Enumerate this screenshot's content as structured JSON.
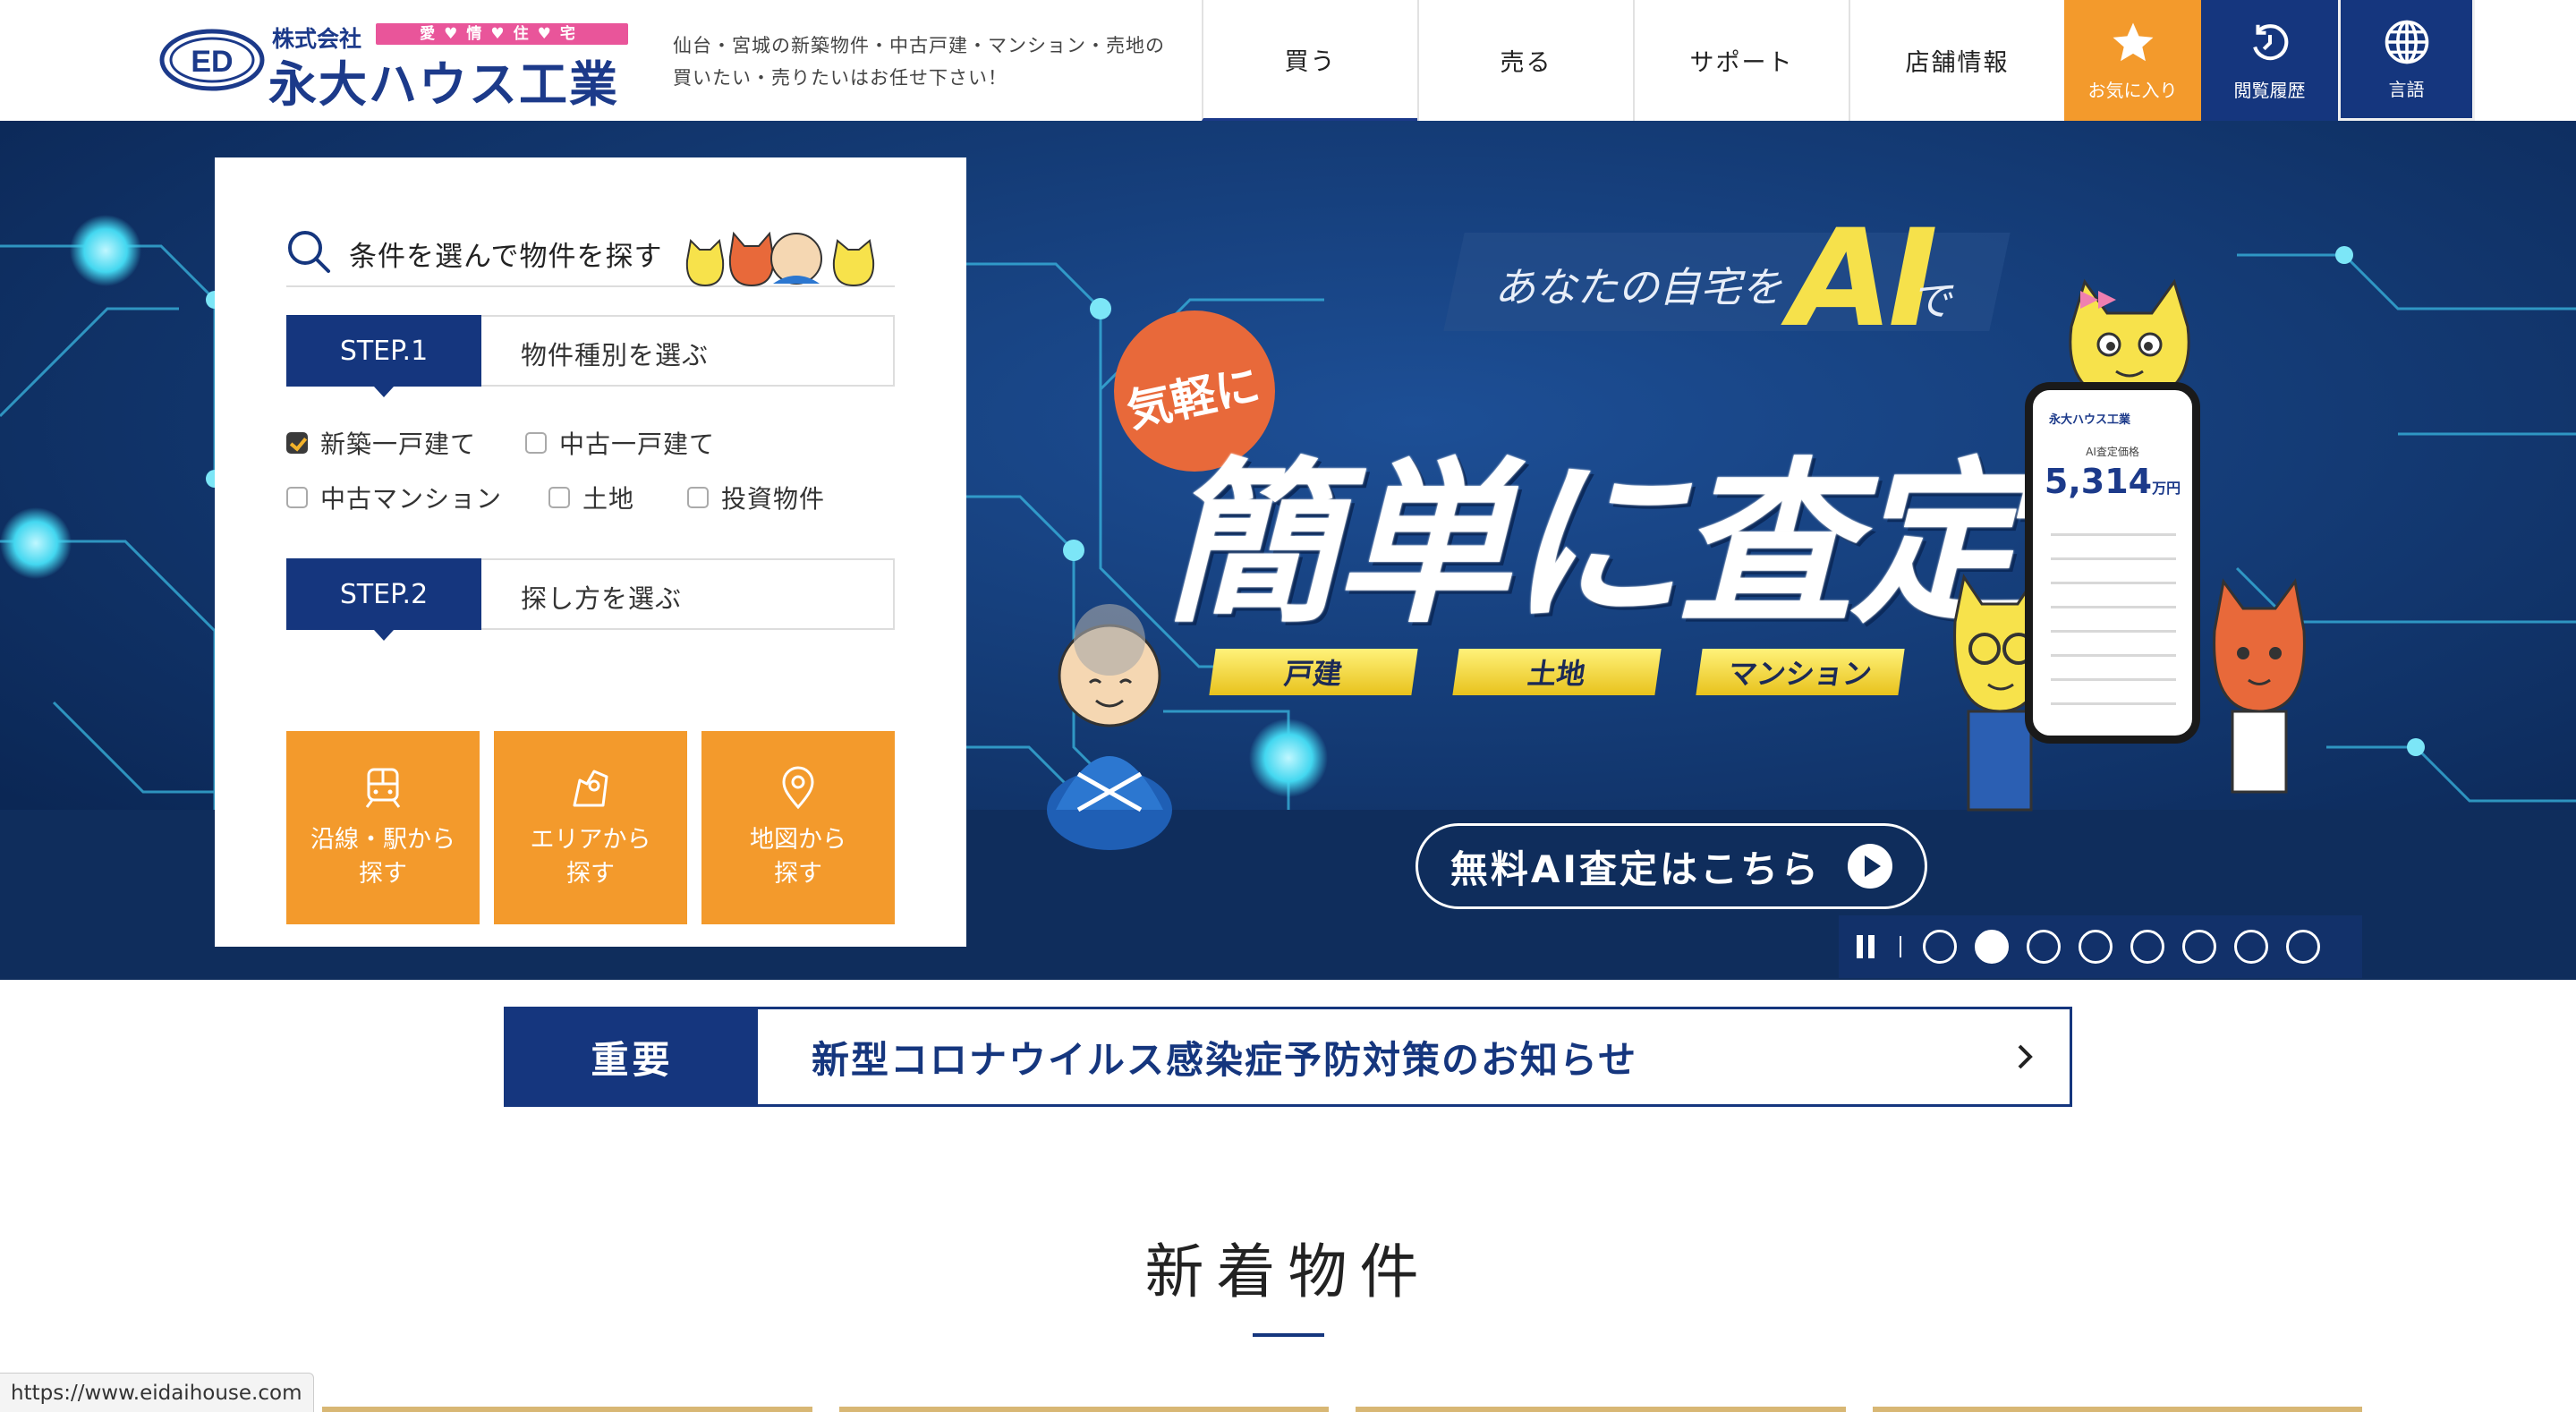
{
  "header": {
    "logo_small": "株式会社",
    "logo_tag": "愛♥情♥住♥宅",
    "logo_main": "永大ハウス工業",
    "tagline": "仙台・宮城の新築物件・中古戸建・マンション・売地の買いたい・売りたいはお任せ下さい！",
    "nav": [
      "買う",
      "売る",
      "サポート",
      "店舗情報"
    ],
    "favorites_label": "お気に入り",
    "history_label": "閲覧履歴",
    "language_label": "言語",
    "brand_color": "#15367e",
    "accent_color": "#f39a2c"
  },
  "search_panel": {
    "title": "条件を選んで物件を探す",
    "step1": {
      "tab": "STEP.1",
      "label": "物件種別を選ぶ",
      "options": [
        {
          "label": "新築一戸建て",
          "checked": true
        },
        {
          "label": "中古一戸建て",
          "checked": false
        },
        {
          "label": "中古マンション",
          "checked": false
        },
        {
          "label": "土地",
          "checked": false
        },
        {
          "label": "投資物件",
          "checked": false
        }
      ]
    },
    "step2": {
      "tab": "STEP.2",
      "label": "探し方を選ぶ",
      "methods": [
        {
          "line1": "沿線・駅から",
          "line2": "探す",
          "icon": "train-icon"
        },
        {
          "line1": "エリアから",
          "line2": "探す",
          "icon": "map-area-icon"
        },
        {
          "line1": "地図から",
          "line2": "探す",
          "icon": "map-pin-icon"
        }
      ]
    }
  },
  "hero": {
    "copy_top": "あなたの自宅を",
    "copy_ai": "AI",
    "copy_de": "で",
    "circle_text": "気軽に",
    "main": "簡単に査定",
    "tags": [
      "戸建",
      "土地",
      "マンション"
    ],
    "cta": "無料AI査定はこちら",
    "phone": {
      "brand": "永大ハウス工業",
      "label": "AI査定価格",
      "value": "5,314",
      "unit": "万円"
    },
    "slides": {
      "count": 8,
      "active_index": 1
    }
  },
  "notice": {
    "tag": "重要",
    "text": "新型コロナウイルス感染症予防対策のお知らせ"
  },
  "section": {
    "title": "新着物件"
  },
  "status_url": "https://www.eidaihouse.com"
}
